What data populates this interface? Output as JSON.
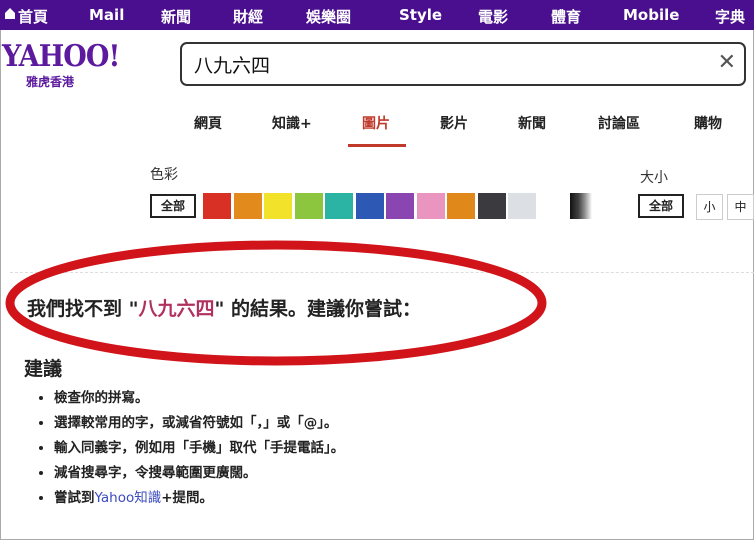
{
  "topnav": {
    "items": [
      "首頁",
      "Mail",
      "新聞",
      "財經",
      "娛樂圈",
      "Style",
      "電影",
      "體育",
      "Mobile",
      "字典"
    ]
  },
  "logo": {
    "wordmark": "YAHOO!",
    "subtitle": "雅虎香港"
  },
  "search": {
    "value": "八九六四",
    "clear_icon": "close-icon"
  },
  "tabs": {
    "items": [
      "網頁",
      "知識+",
      "圖片",
      "影片",
      "新聞",
      "討論區",
      "購物"
    ],
    "active_index": 2
  },
  "filters": {
    "color_label": "色彩",
    "color_all": "全部",
    "colors": [
      "#d93026",
      "#e38a1c",
      "#f2e32a",
      "#8cc63f",
      "#2bb3a3",
      "#2d59b5",
      "#8a45b0",
      "#e995c0",
      "#e0881a",
      "#3a3a3f",
      "#dcdfe3"
    ],
    "size_label": "大小",
    "size_all": "全部",
    "size_small": "小",
    "size_medium": "中"
  },
  "results": {
    "notfound_prefix": "我們找不到 \"",
    "notfound_query": "八九六四",
    "notfound_suffix": "\" 的結果。建議你嘗試：",
    "suggest_title": "建議",
    "tips": [
      "檢查你的拼寫。",
      "選擇較常用的字，或減省符號如「，」或「@」。",
      "輸入同義字，例如用「手機」取代「手提電話」。",
      "減省搜尋字，令搜尋範圍更廣闊。"
    ],
    "tip_last_prefix": "嘗試到",
    "tip_last_link": "Yahoo知識",
    "tip_last_suffix": "+提問。"
  },
  "colors": {
    "brand": "#4a0f8e",
    "accent": "#c0392b",
    "ellipse": "#d0141a"
  }
}
